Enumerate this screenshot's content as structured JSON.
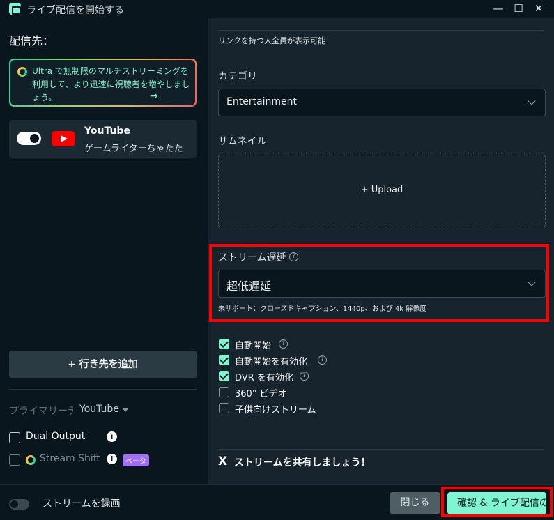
{
  "window": {
    "title": "ライブ配信を開始する",
    "min_glyph": "—",
    "max_glyph": "☐",
    "close_glyph": "✕"
  },
  "left": {
    "destinations_title": "配信先：",
    "ultra_promo": "Ultra で無制限のマルチストリーミングを利用して、より迅速に視聴者を増やしましょう。",
    "ultra_arrow": "→",
    "youtube_card": {
      "name": "YouTube",
      "account": "ゲームライターちゃたた",
      "enabled": true
    },
    "add_destination": "+ 行き先を追加",
    "primary_label": "プライマリーデ",
    "primary_value": "YouTube",
    "dual_output": {
      "label": "Dual Output",
      "checked": false
    },
    "stream_shift": {
      "label": "Stream Shift",
      "checked": false,
      "badge": "ベータ"
    },
    "info_glyph": "i"
  },
  "right": {
    "visibility_note": "リンクを持つ人全員が表示可能",
    "category": {
      "label": "カテゴリ",
      "value": "Entertainment"
    },
    "thumbnail": {
      "label": "サムネイル",
      "upload": "+ Upload"
    },
    "latency": {
      "label": "ストリーム遅延",
      "value": "超低遅延",
      "note": "未サポート：クローズドキャプション、1440p、および 4k 解像度"
    },
    "help_glyph": "?",
    "options": [
      {
        "label": "自動開始",
        "checked": true,
        "help": true
      },
      {
        "label": "自動開始を有効化",
        "checked": true,
        "help": true
      },
      {
        "label": "DVR を有効化",
        "checked": true,
        "help": true
      },
      {
        "label": "360° ビデオ",
        "checked": false,
        "help": false
      },
      {
        "label": "子供向けストリーム",
        "checked": false,
        "help": false
      }
    ],
    "share": {
      "icon": "X",
      "label": "ストリームを共有しましょう！"
    }
  },
  "footer": {
    "record_label": "ストリームを録画",
    "record_enabled": false,
    "close_button": "閉じる",
    "confirm_button": "確認 & ライブ配信の"
  },
  "colors": {
    "accent": "#80f5d2",
    "highlight": "#ff0000",
    "youtube": "#ff0000",
    "beta": "#a26ef6"
  }
}
